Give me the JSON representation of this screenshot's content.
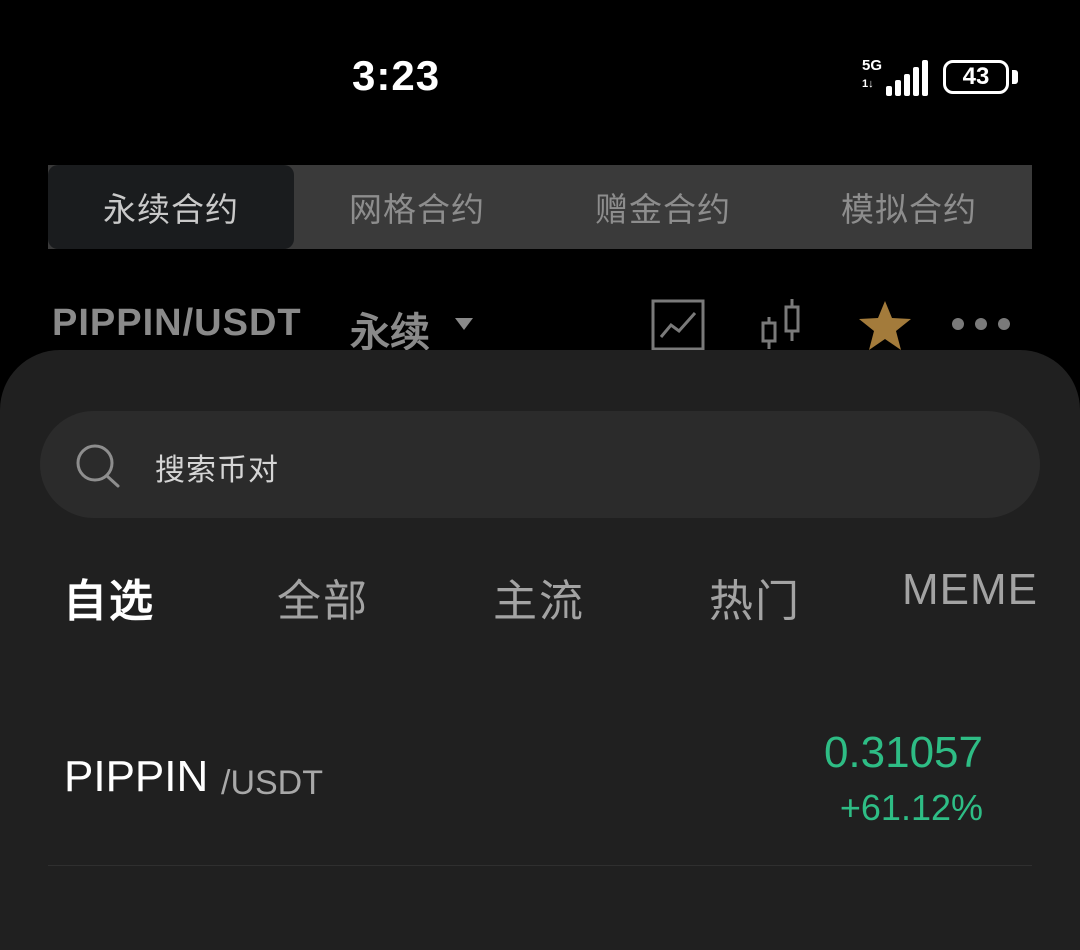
{
  "status_bar": {
    "time": "3:23",
    "network": "5G",
    "network_sub": "1↓",
    "battery": "43"
  },
  "contract_tabs": [
    {
      "label": "永续合约",
      "active": true
    },
    {
      "label": "网格合约",
      "active": false
    },
    {
      "label": "赠金合约",
      "active": false
    },
    {
      "label": "模拟合约",
      "active": false
    }
  ],
  "pair_header": {
    "pair": "PIPPIN/USDT",
    "type": "永续"
  },
  "icons": {
    "chart": "line-chart-icon",
    "candles": "candlestick-icon",
    "favorite": "star-icon",
    "more": "more-icon"
  },
  "colors": {
    "up": "#2ebd85",
    "star": "#a37b3b"
  },
  "search": {
    "placeholder": "搜索币对"
  },
  "categories": [
    {
      "label": "自选",
      "active": true
    },
    {
      "label": "全部",
      "active": false
    },
    {
      "label": "主流",
      "active": false
    },
    {
      "label": "热门",
      "active": false
    },
    {
      "label": "MEME",
      "active": false
    }
  ],
  "list": [
    {
      "coin": "PIPPIN",
      "quote": "/USDT",
      "price": "0.31057",
      "change": "+61.12%"
    }
  ]
}
